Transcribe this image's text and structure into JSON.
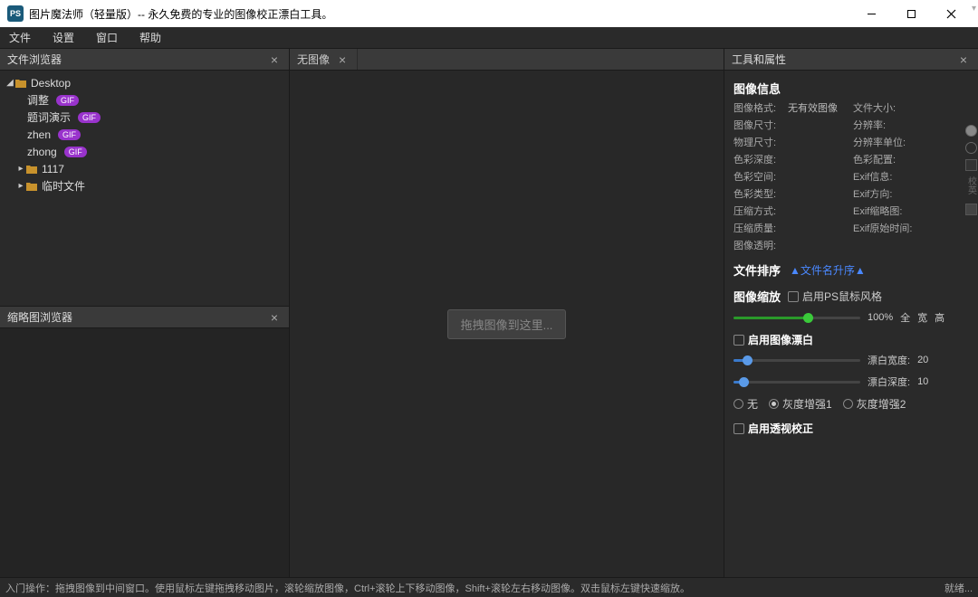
{
  "title": "图片魔法师（轻量版）-- 永久免费的专业的图像校正漂白工具。",
  "menu": [
    "文件",
    "设置",
    "窗口",
    "帮助"
  ],
  "panels": {
    "file_browser": {
      "title": "文件浏览器"
    },
    "thumb_browser": {
      "title": "缩略图浏览器"
    },
    "tools": {
      "title": "工具和属性"
    }
  },
  "tree": {
    "root": "Desktop",
    "items": [
      {
        "label": "调整",
        "gif": "GIF"
      },
      {
        "label": "题词演示",
        "gif": "GIF"
      },
      {
        "label": "zhen",
        "gif": "GIF"
      },
      {
        "label": "zhong",
        "gif": "GIF"
      }
    ],
    "folders": [
      {
        "label": "1117"
      },
      {
        "label": "临时文件"
      }
    ]
  },
  "center": {
    "tab_label": "无图像",
    "drop_hint": "拖拽图像到这里..."
  },
  "image_info": {
    "title": "图像信息",
    "rows": [
      [
        "图像格式:",
        "无有效图像",
        "文件大小:",
        ""
      ],
      [
        "图像尺寸:",
        "",
        "分辨率:",
        ""
      ],
      [
        "物理尺寸:",
        "",
        "分辨率单位:",
        ""
      ],
      [
        "色彩深度:",
        "",
        "色彩配置:",
        ""
      ],
      [
        "色彩空间:",
        "",
        "Exif信息:",
        ""
      ],
      [
        "色彩类型:",
        "",
        "Exif方向:",
        ""
      ],
      [
        "压缩方式:",
        "",
        "Exif缩略图:",
        ""
      ],
      [
        "压缩质量:",
        "",
        "Exif原始时间:",
        ""
      ],
      [
        "图像透明:",
        "",
        "",
        ""
      ]
    ]
  },
  "sort": {
    "title": "文件排序",
    "link": "▲文件名升序▲"
  },
  "zoom": {
    "title": "图像缩放",
    "ps_checkbox": "启用PS鼠标风格",
    "percent": "100%",
    "all": "全",
    "wide": "宽",
    "high": "高"
  },
  "bleach": {
    "checkbox": "启用图像漂白",
    "width_label": "漂白宽度:",
    "width_val": "20",
    "depth_label": "漂白深度:",
    "depth_val": "10",
    "radio_none": "无",
    "radio_g1": "灰度增强1",
    "radio_g2": "灰度增强2"
  },
  "perspective": {
    "checkbox": "启用透视校正"
  },
  "edge_text": "校英",
  "statusbar": {
    "help": "入门操作：拖拽图像到中间窗口。使用鼠标左键拖拽移动图片，滚轮缩放图像，Ctrl+滚轮上下移动图像，Shift+滚轮左右移动图像。双击鼠标左键快速缩放。",
    "ready": "就绪..."
  }
}
